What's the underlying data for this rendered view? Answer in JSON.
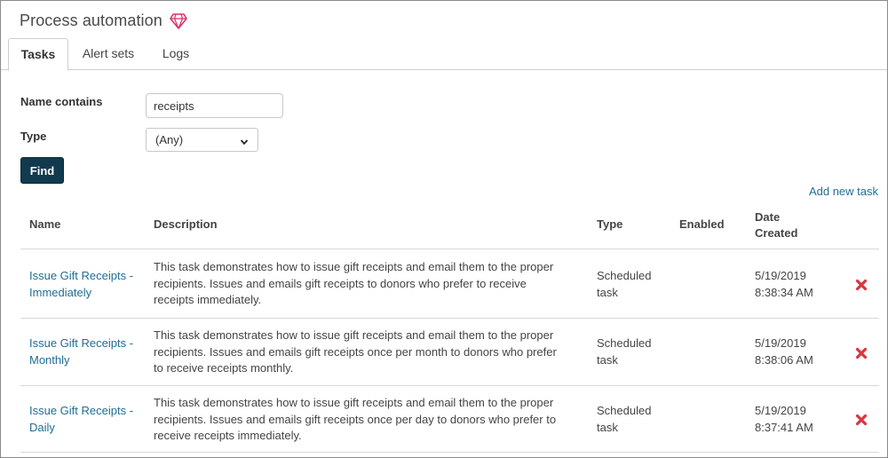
{
  "header": {
    "title": "Process automation",
    "icon": "gem-icon"
  },
  "tabs": [
    {
      "label": "Tasks",
      "active": true
    },
    {
      "label": "Alert sets",
      "active": false
    },
    {
      "label": "Logs",
      "active": false
    }
  ],
  "filters": {
    "name_label": "Name contains",
    "name_value": "receipts",
    "type_label": "Type",
    "type_value": "(Any)",
    "find_label": "Find"
  },
  "add_task_label": "Add new task",
  "table": {
    "columns": {
      "name": "Name",
      "description": "Description",
      "type": "Type",
      "enabled": "Enabled",
      "date_line1": "Date",
      "date_line2": "Created"
    },
    "rows": [
      {
        "name_line1": "Issue Gift Receipts -",
        "name_line2": "Immediately",
        "desc_line1": "This task demonstrates how to issue gift receipts and email them to the proper",
        "desc_line2": "recipients. Issues and emails gift receipts to donors who prefer to receive",
        "desc_line3": "receipts immediately.",
        "type_line1": "Scheduled",
        "type_line2": "task",
        "enabled": "",
        "date_line1": "5/19/2019",
        "date_line2": "8:38:34 AM"
      },
      {
        "name_line1": "Issue Gift Receipts -",
        "name_line2": "Monthly",
        "desc_line1": "This task demonstrates how to issue gift receipts and email them to the proper",
        "desc_line2": "recipients. Issues and emails gift receipts once per month to donors who prefer",
        "desc_line3": "to receive receipts monthly.",
        "type_line1": "Scheduled",
        "type_line2": "task",
        "enabled": "",
        "date_line1": "5/19/2019",
        "date_line2": "8:38:06 AM"
      },
      {
        "name_line1": "Issue Gift Receipts -",
        "name_line2": "Daily",
        "desc_line1": "This task demonstrates how to issue gift receipts and email them to the proper",
        "desc_line2": "recipients. Issues and emails gift receipts once per day to donors who prefer to",
        "desc_line3": "receive receipts immediately.",
        "type_line1": "Scheduled",
        "type_line2": "task",
        "enabled": "",
        "date_line1": "5/19/2019",
        "date_line2": "8:37:41 AM"
      }
    ]
  },
  "colors": {
    "accent": "#1f6e96",
    "button": "#123a4e",
    "delete": "#d9363e",
    "gem": "#d6336c"
  }
}
